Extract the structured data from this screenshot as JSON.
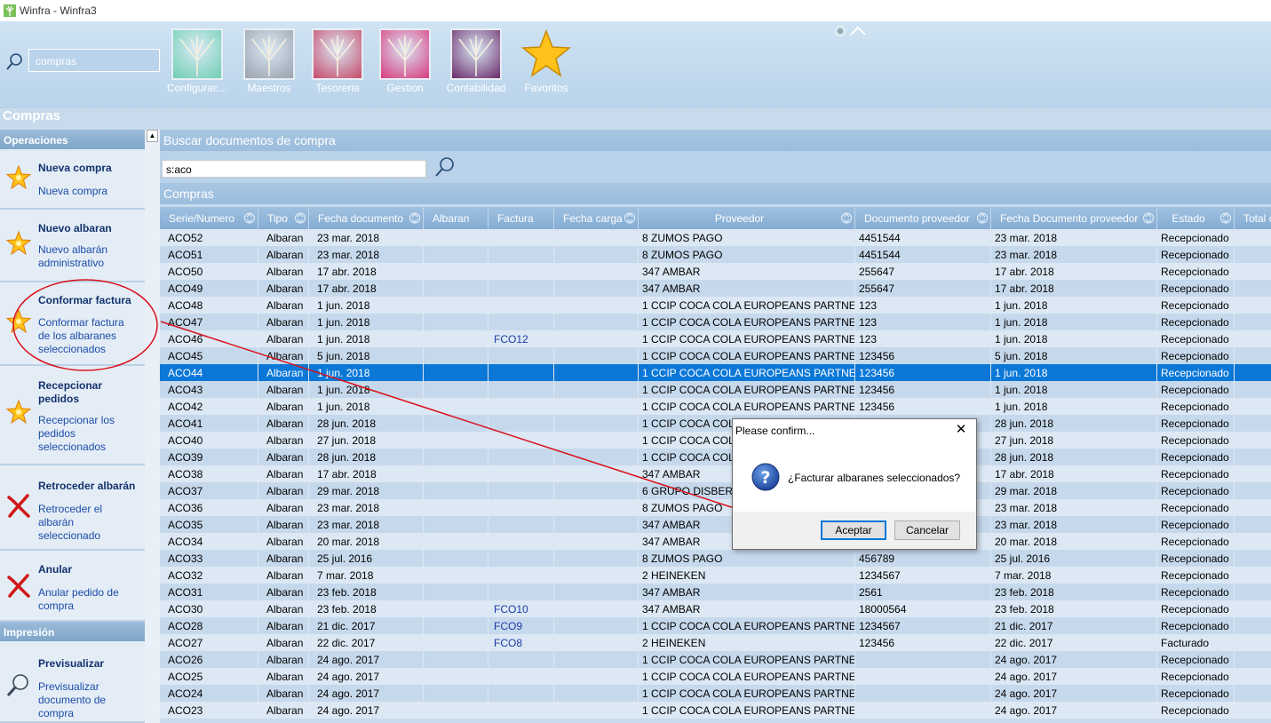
{
  "window": {
    "title": "Winfra - Winfra3",
    "app_icon": "tree-app-icon"
  },
  "ribbon": {
    "search_placeholder": "compras",
    "modules": [
      {
        "label": "Configurac...",
        "color": "#6fd0b4",
        "icon": "tree-icon"
      },
      {
        "label": "Maestros",
        "color": "#9aa2ad",
        "icon": "tree-icon"
      },
      {
        "label": "Tesoreria",
        "color": "#c74a6a",
        "icon": "tree-icon"
      },
      {
        "label": "Gestion",
        "color": "#d83a7e",
        "icon": "tree-icon"
      },
      {
        "label": "Contabilidad",
        "color": "#6b2a6a",
        "icon": "tree-icon"
      },
      {
        "label": "Favoritos",
        "color": "#ffc21a",
        "icon": "star-icon"
      }
    ]
  },
  "section_title": "Compras",
  "sidebar": {
    "operaciones_header": "Operaciones",
    "impresion_header": "Impresión",
    "items": [
      {
        "title": "Nueva compra",
        "desc": "Nueva compra",
        "icon": "star-icon"
      },
      {
        "title": "Nuevo albaran",
        "desc": "Nuevo albarán administrativo",
        "icon": "star-icon"
      },
      {
        "title": "Conformar factura",
        "desc": "Conformar factura de los albaranes seleccionados",
        "icon": "star-icon"
      },
      {
        "title": "Recepcionar pedidos",
        "desc": "Recepcionar los pedidos seleccionados",
        "icon": "star-icon"
      },
      {
        "title": "Retroceder albarán",
        "desc": "Retroceder el albarán seleccionado",
        "icon": "red-x-icon"
      },
      {
        "title": "Anular",
        "desc": "Anular pedido de compra",
        "icon": "red-x-icon"
      },
      {
        "title": "Previsualizar",
        "desc": "Previsualizar documento de compra",
        "icon": "magnifier-icon"
      }
    ]
  },
  "main": {
    "search_bar_title": "Buscar documentos de compra",
    "search_value": "s:aco",
    "grid_title": "Compras",
    "columns": [
      "Serie/Numero",
      "Tipo",
      "Fecha documento",
      "Albaran",
      "Factura",
      "Fecha carga",
      "Proveedor",
      "Documento proveedor",
      "Fecha Documento proveedor",
      "Estado",
      "Total c"
    ],
    "selected_row_index": 8,
    "rows": [
      [
        "ACO52",
        "Albaran",
        "23 mar. 2018",
        "",
        "",
        "",
        "8 ZUMOS PAGO",
        "4451544",
        "23 mar. 2018",
        "Recepcionado"
      ],
      [
        "ACO51",
        "Albaran",
        "23 mar. 2018",
        "",
        "",
        "",
        "8 ZUMOS PAGO",
        "4451544",
        "23 mar. 2018",
        "Recepcionado"
      ],
      [
        "ACO50",
        "Albaran",
        "17 abr. 2018",
        "",
        "",
        "",
        "347 AMBAR",
        "255647",
        "17 abr. 2018",
        "Recepcionado"
      ],
      [
        "ACO49",
        "Albaran",
        "17 abr. 2018",
        "",
        "",
        "",
        "347 AMBAR",
        "255647",
        "17 abr. 2018",
        "Recepcionado"
      ],
      [
        "ACO48",
        "Albaran",
        "1 jun. 2018",
        "",
        "",
        "",
        "1 CCIP COCA COLA EUROPEANS PARTNERS",
        "123",
        "1 jun. 2018",
        "Recepcionado"
      ],
      [
        "ACO47",
        "Albaran",
        "1 jun. 2018",
        "",
        "",
        "",
        "1 CCIP COCA COLA EUROPEANS PARTNERS",
        "123",
        "1 jun. 2018",
        "Recepcionado"
      ],
      [
        "ACO46",
        "Albaran",
        "1 jun. 2018",
        "",
        "FCO12",
        "",
        "1 CCIP COCA COLA EUROPEANS PARTNERS",
        "123",
        "1 jun. 2018",
        "Recepcionado"
      ],
      [
        "ACO45",
        "Albaran",
        "5 jun. 2018",
        "",
        "",
        "",
        "1 CCIP COCA COLA EUROPEANS PARTNERS",
        "123456",
        "5 jun. 2018",
        "Recepcionado"
      ],
      [
        "ACO44",
        "Albaran",
        "1 jun. 2018",
        "",
        "",
        "",
        "1 CCIP COCA COLA EUROPEANS PARTNERS",
        "123456",
        "1 jun. 2018",
        "Recepcionado"
      ],
      [
        "ACO43",
        "Albaran",
        "1 jun. 2018",
        "",
        "",
        "",
        "1 CCIP COCA COLA EUROPEANS PARTNERS",
        "123456",
        "1 jun. 2018",
        "Recepcionado"
      ],
      [
        "ACO42",
        "Albaran",
        "1 jun. 2018",
        "",
        "",
        "",
        "1 CCIP COCA COLA EUROPEANS PARTNERS",
        "123456",
        "1 jun. 2018",
        "Recepcionado"
      ],
      [
        "ACO41",
        "Albaran",
        "28 jun. 2018",
        "",
        "",
        "",
        "1 CCIP COCA COLA",
        "",
        "28 jun. 2018",
        "Recepcionado"
      ],
      [
        "ACO40",
        "Albaran",
        "27 jun. 2018",
        "",
        "",
        "",
        "1 CCIP COCA COLA",
        "",
        "27 jun. 2018",
        "Recepcionado"
      ],
      [
        "ACO39",
        "Albaran",
        "28 jun. 2018",
        "",
        "",
        "",
        "1 CCIP COCA COLA",
        "",
        "28 jun. 2018",
        "Recepcionado"
      ],
      [
        "ACO38",
        "Albaran",
        "17 abr. 2018",
        "",
        "",
        "",
        "347 AMBAR",
        "",
        "17 abr. 2018",
        "Recepcionado"
      ],
      [
        "ACO37",
        "Albaran",
        "29 mar. 2018",
        "",
        "",
        "",
        "6 GRUPO DISBER SL",
        "",
        "29 mar. 2018",
        "Recepcionado"
      ],
      [
        "ACO36",
        "Albaran",
        "23 mar. 2018",
        "",
        "",
        "",
        "8 ZUMOS PAGO",
        "",
        "23 mar. 2018",
        "Recepcionado"
      ],
      [
        "ACO35",
        "Albaran",
        "23 mar. 2018",
        "",
        "",
        "",
        "347 AMBAR",
        "",
        "23 mar. 2018",
        "Recepcionado"
      ],
      [
        "ACO34",
        "Albaran",
        "20 mar. 2018",
        "",
        "",
        "",
        "347 AMBAR",
        "",
        "20 mar. 2018",
        "Recepcionado"
      ],
      [
        "ACO33",
        "Albaran",
        "25 jul. 2016",
        "",
        "",
        "",
        "8 ZUMOS PAGO",
        "456789",
        "25 jul. 2016",
        "Recepcionado"
      ],
      [
        "ACO32",
        "Albaran",
        "7 mar. 2018",
        "",
        "",
        "",
        "2 HEINEKEN",
        "1234567",
        "7 mar. 2018",
        "Recepcionado"
      ],
      [
        "ACO31",
        "Albaran",
        "23 feb. 2018",
        "",
        "",
        "",
        "347 AMBAR",
        "2561",
        "23 feb. 2018",
        "Recepcionado"
      ],
      [
        "ACO30",
        "Albaran",
        "23 feb. 2018",
        "",
        "FCO10",
        "",
        "347 AMBAR",
        "18000564",
        "23 feb. 2018",
        "Recepcionado"
      ],
      [
        "ACO28",
        "Albaran",
        "21 dic. 2017",
        "",
        "FCO9",
        "",
        "1 CCIP COCA COLA EUROPEANS PARTNERS",
        "1234567",
        "21 dic. 2017",
        "Recepcionado"
      ],
      [
        "ACO27",
        "Albaran",
        "22 dic. 2017",
        "",
        "FCO8",
        "",
        "2 HEINEKEN",
        "123456",
        "22 dic. 2017",
        "Facturado"
      ],
      [
        "ACO26",
        "Albaran",
        "24 ago. 2017",
        "",
        "",
        "",
        "1 CCIP COCA COLA EUROPEANS PARTNERS",
        "",
        "24 ago. 2017",
        "Recepcionado"
      ],
      [
        "ACO25",
        "Albaran",
        "24 ago. 2017",
        "",
        "",
        "",
        "1 CCIP COCA COLA EUROPEANS PARTNERS",
        "",
        "24 ago. 2017",
        "Recepcionado"
      ],
      [
        "ACO24",
        "Albaran",
        "24 ago. 2017",
        "",
        "",
        "",
        "1 CCIP COCA COLA EUROPEANS PARTNERS",
        "",
        "24 ago. 2017",
        "Recepcionado"
      ],
      [
        "ACO23",
        "Albaran",
        "24 ago. 2017",
        "",
        "",
        "",
        "1 CCIP COCA COLA EUROPEANS PARTNERS",
        "",
        "24 ago. 2017",
        "Recepcionado"
      ]
    ]
  },
  "dialog": {
    "title": "Please confirm...",
    "message": "¿Facturar albaranes seleccionados?",
    "accept_label": "Aceptar",
    "cancel_label": "Cancelar",
    "icon": "question-icon",
    "close_glyph": "✕"
  },
  "annotation_color": "#d9101a"
}
